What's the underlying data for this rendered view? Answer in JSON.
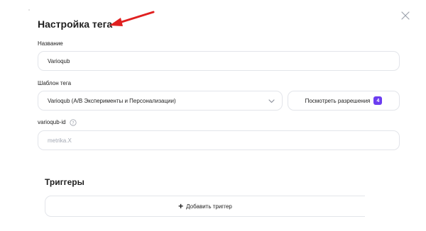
{
  "dialog": {
    "title": "Настройка тега",
    "close_icon": "close-icon",
    "annotation_color": "#e02020"
  },
  "fields": {
    "name": {
      "label": "Название",
      "value": "Varioqub"
    },
    "template": {
      "label": "Шаблон тега",
      "value": "Varioqub (A/B Эксперименты и Персонализации)",
      "dropdown_icon": "chevron-down-icon"
    },
    "permissions": {
      "label": "Посмотреть разрешения",
      "count": "4",
      "badge_color": "#6c3df0"
    },
    "varioqub_id": {
      "label": "varioqub-id",
      "help_icon": "question-circle-icon",
      "placeholder": "metrika.X"
    }
  },
  "triggers": {
    "title": "Триггеры",
    "add_label": "Добавить триггер",
    "add_icon": "plus-icon"
  }
}
